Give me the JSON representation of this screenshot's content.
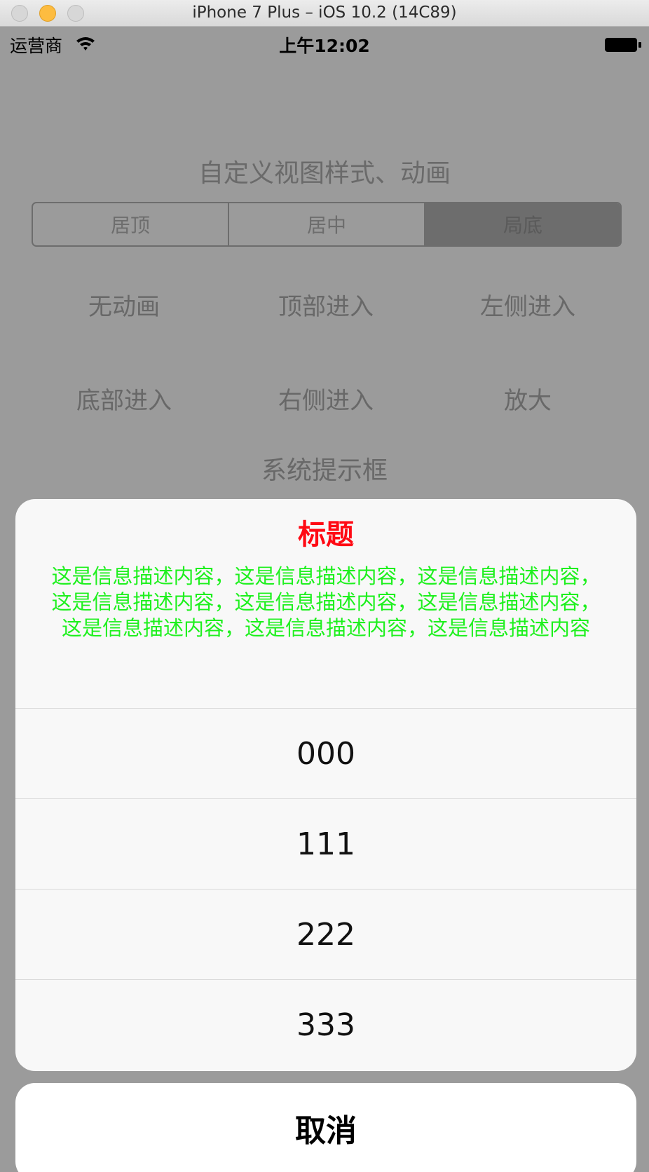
{
  "window": {
    "title": "iPhone 7 Plus – iOS 10.2 (14C89)"
  },
  "status_bar": {
    "carrier": "运营商",
    "time": "上午12:02",
    "wifi_icon": "wifi-icon",
    "battery_icon": "battery-icon"
  },
  "content": {
    "title": "自定义视图样式、动画",
    "segments": [
      {
        "label": "居顶",
        "selected": false
      },
      {
        "label": "居中",
        "selected": false
      },
      {
        "label": "局底",
        "selected": true
      }
    ],
    "buttons": [
      {
        "label": "无动画"
      },
      {
        "label": "顶部进入"
      },
      {
        "label": "左侧进入"
      },
      {
        "label": "底部进入"
      },
      {
        "label": "右侧进入"
      },
      {
        "label": "放大"
      }
    ],
    "system_alert_button": "系统提示框"
  },
  "action_sheet": {
    "title": "标题",
    "message": "这是信息描述内容，这是信息描述内容，这是信息描述内容，这是信息描述内容，这是信息描述内容，这是信息描述内容，这是信息描述内容，这是信息描述内容，这是信息描述内容",
    "options": [
      "000",
      "111",
      "222",
      "333"
    ],
    "cancel": "取消",
    "colors": {
      "title": "#ff0a14",
      "message": "#1ef01e"
    }
  }
}
